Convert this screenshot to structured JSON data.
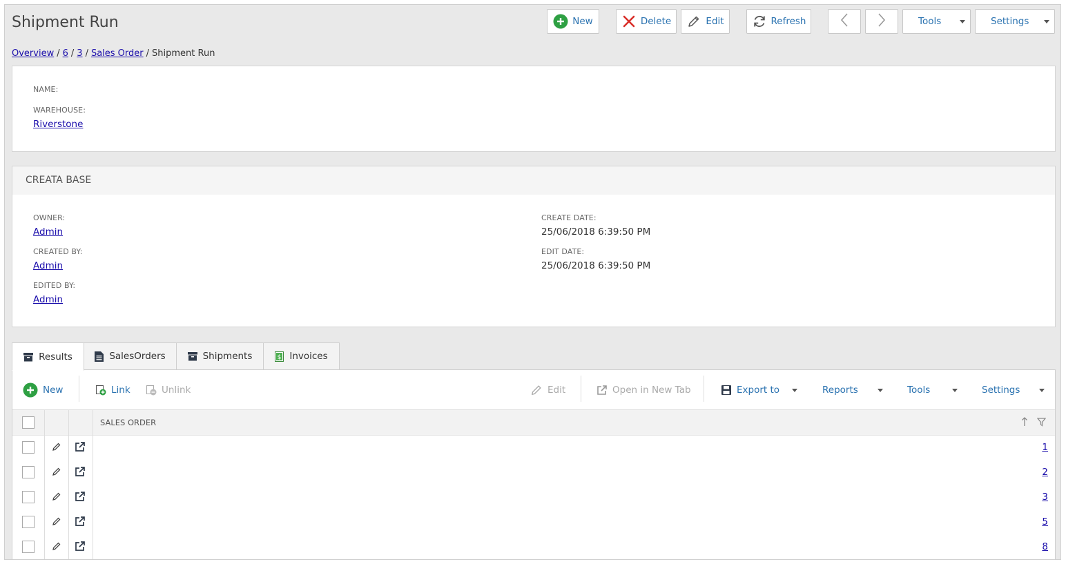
{
  "header": {
    "title": "Shipment Run"
  },
  "toolbar": {
    "new_label": "New",
    "delete_label": "Delete",
    "edit_label": "Edit",
    "refresh_label": "Refresh",
    "tools_label": "Tools",
    "settings_label": "Settings"
  },
  "breadcrumb": [
    {
      "label": "Overview",
      "link": true
    },
    {
      "label": "6",
      "link": true
    },
    {
      "label": "3",
      "link": true
    },
    {
      "label": "Sales Order",
      "link": true
    },
    {
      "label": "Shipment Run",
      "link": false
    }
  ],
  "details": {
    "name_label": "NAME:",
    "warehouse_label": "WAREHOUSE:",
    "warehouse_value": "Riverstone"
  },
  "creata_base": {
    "heading": "CREATA BASE",
    "owner_label": "OWNER:",
    "owner_value": "Admin",
    "created_by_label": "CREATED BY:",
    "created_by_value": "Admin",
    "edited_by_label": "EDITED BY:",
    "edited_by_value": "Admin",
    "create_date_label": "CREATE DATE:",
    "create_date_value": "25/06/2018 6:39:50 PM",
    "edit_date_label": "EDIT DATE:",
    "edit_date_value": "25/06/2018 6:39:50 PM"
  },
  "tabs": [
    {
      "label": "Results",
      "icon": "archive-icon",
      "active": true
    },
    {
      "label": "SalesOrders",
      "icon": "document-icon",
      "active": false
    },
    {
      "label": "Shipments",
      "icon": "archive-icon",
      "active": false
    },
    {
      "label": "Invoices",
      "icon": "invoice-icon",
      "active": false
    }
  ],
  "grid_toolbar": {
    "new_label": "New",
    "link_label": "Link",
    "unlink_label": "Unlink",
    "edit_label": "Edit",
    "open_tab_label": "Open in New Tab",
    "export_label": "Export to",
    "reports_label": "Reports",
    "tools_label": "Tools",
    "settings_label": "Settings"
  },
  "grid": {
    "column_header": "SALES ORDER",
    "rows": [
      "1",
      "2",
      "3",
      "5",
      "8"
    ]
  },
  "colors": {
    "accent_blue": "#2a72b0",
    "link": "#1a0dab",
    "new_green": "#2ea043",
    "delete_red": "#d9302b",
    "background": "#e9e9e9"
  }
}
